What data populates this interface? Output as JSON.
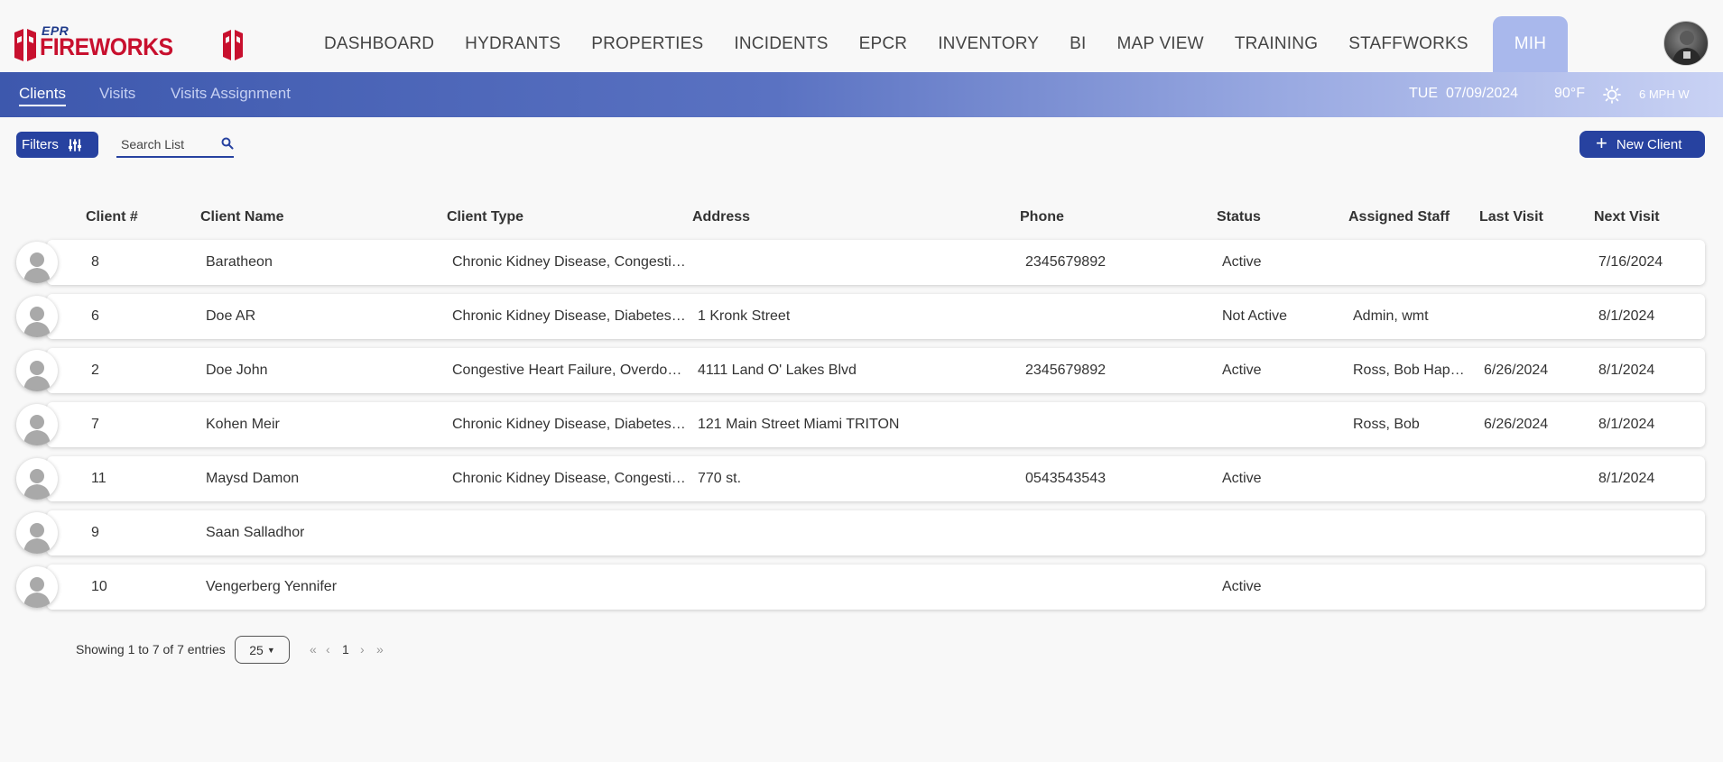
{
  "header": {
    "logo_epr": "EPR",
    "logo_name": "FIREWORKS",
    "nav": [
      "DASHBOARD",
      "HYDRANTS",
      "PROPERTIES",
      "INCIDENTS",
      "EPCR",
      "INVENTORY",
      "BI",
      "MAP VIEW",
      "TRAINING",
      "STAFFWORKS",
      "MIH"
    ],
    "active_nav": "MIH"
  },
  "subnav": {
    "tabs": [
      "Clients",
      "Visits",
      "Visits Assignment"
    ],
    "day": "TUE",
    "date": "07/09/2024",
    "temperature": "90°F",
    "wind": "6 MPH W"
  },
  "toolbar": {
    "filters_label": "Filters",
    "search_placeholder": "Search List",
    "new_client_label": "New Client"
  },
  "table": {
    "columns": [
      "Client #",
      "Client Name",
      "Client Type",
      "Address",
      "Phone",
      "Status",
      "Assigned Staff",
      "Last Visit",
      "Next Visit"
    ],
    "rows": [
      {
        "num": "8",
        "name": "Baratheon",
        "type": "Chronic Kidney Disease, Congesti…",
        "address": "",
        "phone": "2345679892",
        "status": "Active",
        "staff": "",
        "last": "",
        "next": "7/16/2024"
      },
      {
        "num": "6",
        "name": "Doe AR",
        "type": "Chronic Kidney Disease, Diabetes…",
        "address": "1 Kronk Street",
        "phone": "",
        "status": "Not Active",
        "staff": "Admin, wmt",
        "last": "",
        "next": "8/1/2024"
      },
      {
        "num": "2",
        "name": "Doe John",
        "type": "Congestive Heart Failure, Overdo…",
        "address": "4111 Land O' Lakes Blvd",
        "phone": "2345679892",
        "status": "Active",
        "staff": "Ross, Bob Happ…",
        "last": "6/26/2024",
        "next": "8/1/2024"
      },
      {
        "num": "7",
        "name": "Kohen Meir",
        "type": "Chronic Kidney Disease, Diabetes…",
        "address": "121 Main Street Miami TRITON",
        "phone": "",
        "status": "",
        "staff": "Ross, Bob",
        "last": "6/26/2024",
        "next": "8/1/2024"
      },
      {
        "num": "11",
        "name": "Maysd Damon",
        "type": "Chronic Kidney Disease, Congesti…",
        "address": "770 st.",
        "phone": "0543543543",
        "status": "Active",
        "staff": "",
        "last": "",
        "next": "8/1/2024"
      },
      {
        "num": "9",
        "name": "Saan Salladhor",
        "type": "",
        "address": "",
        "phone": "",
        "status": "",
        "staff": "",
        "last": "",
        "next": ""
      },
      {
        "num": "10",
        "name": "Vengerberg Yennifer",
        "type": "",
        "address": "",
        "phone": "",
        "status": "Active",
        "staff": "",
        "last": "",
        "next": ""
      }
    ]
  },
  "footer": {
    "showing": "Showing 1 to 7 of 7 entries",
    "page_size": "25",
    "first": "«",
    "prev": "‹",
    "page": "1",
    "next": "›",
    "last": "»"
  }
}
